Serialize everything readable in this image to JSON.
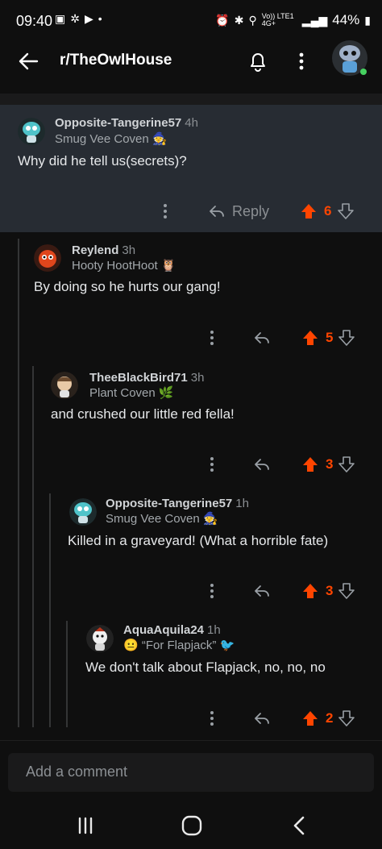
{
  "status": {
    "time": "09:40",
    "battery": "44%",
    "network": "Vo)) LTE1 4G+"
  },
  "header": {
    "title": "r/TheOwlHouse"
  },
  "comments": [
    {
      "user": "Opposite-Tangerine57",
      "age": "4h",
      "flair": "Smug Vee Coven",
      "text": "Why did he tell us(secrets)?",
      "reply_label": "Reply",
      "votes": "6"
    },
    {
      "user": "Reylend",
      "age": "3h",
      "flair": "Hooty HootHoot",
      "text": "By doing so he hurts our gang!",
      "votes": "5"
    },
    {
      "user": "TheeBlackBird71",
      "age": "3h",
      "flair": "Plant Coven",
      "text": "and crushed our little red fella!",
      "votes": "3"
    },
    {
      "user": "Opposite-Tangerine57",
      "age": "1h",
      "flair": "Smug Vee Coven",
      "text": "Killed in a graveyard! (What a horrible fate)",
      "votes": "3"
    },
    {
      "user": "AquaAquila24",
      "age": "1h",
      "flair": "“For Flapjack”",
      "text": "We don't talk about Flapjack, no, no, no",
      "votes": "2"
    }
  ],
  "composer": {
    "placeholder": "Add a comment"
  },
  "colors": {
    "upvote": "#ff4500",
    "highlight_bg": "#272c33",
    "background": "#0f0f0f"
  }
}
